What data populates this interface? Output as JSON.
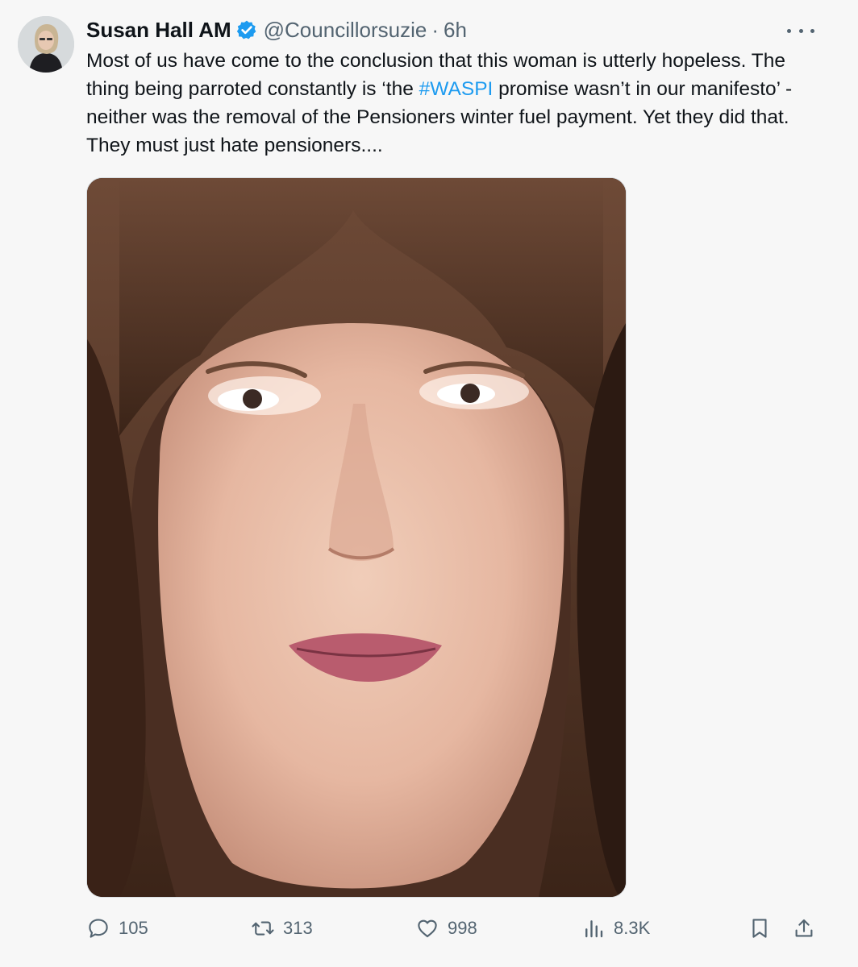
{
  "author": {
    "display_name": "Susan Hall AM",
    "handle": "@Councillorsuzie",
    "separator": "·",
    "time": "6h",
    "verified": true
  },
  "tweet": {
    "text_before_hashtag": "Most of us have come to the conclusion that this woman is utterly hopeless. The thing being parroted constantly is ‘the ",
    "hashtag": "#WASPI",
    "text_after_hashtag": " promise wasn’t in our manifesto’ - neither was the removal of the Pensioners winter fuel payment. Yet they did that. They must just hate pensioners...."
  },
  "actions": {
    "replies": "105",
    "retweets": "313",
    "likes": "998",
    "views": "8.3K"
  },
  "icons": {
    "reply": "speech-bubble-icon",
    "retweet": "retweet-arrows-icon",
    "like": "heart-icon",
    "views": "bar-chart-icon",
    "bookmark": "bookmark-icon",
    "share": "share-upload-icon",
    "more": "ellipsis-icon",
    "verified": "verified-badge-icon"
  },
  "colors": {
    "accent": "#1d9bf0",
    "secondary_text": "#536471",
    "primary_text": "#0f1419",
    "background": "#f7f7f7"
  }
}
